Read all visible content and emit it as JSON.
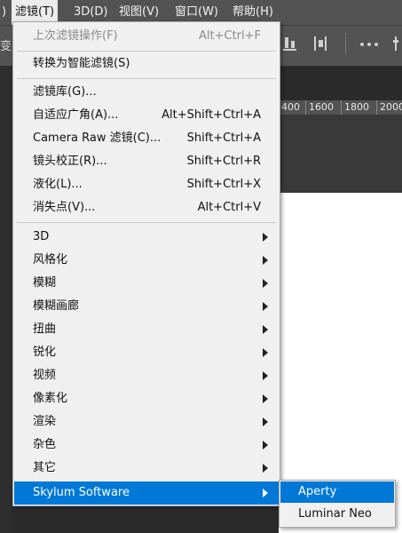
{
  "menubar": {
    "items": [
      {
        "label": ")"
      },
      {
        "label": "滤镜(T)"
      },
      {
        "label": "3D(D)"
      },
      {
        "label": "视图(V)"
      },
      {
        "label": "窗口(W)"
      },
      {
        "label": "帮助(H)"
      }
    ]
  },
  "options_bar": {
    "left_text": "变"
  },
  "ruler": {
    "ticks": [
      "400",
      "1600",
      "1800",
      "2000"
    ]
  },
  "filter_menu": {
    "last_filter": {
      "label": "上次滤镜操作(F)",
      "shortcut": "Alt+Ctrl+F"
    },
    "convert_smart": {
      "label": "转换为智能滤镜(S)"
    },
    "gallery": {
      "label": "滤镜库(G)..."
    },
    "adaptive_wide": {
      "label": "自适应广角(A)...",
      "shortcut": "Alt+Shift+Ctrl+A"
    },
    "camera_raw": {
      "label": "Camera Raw 滤镜(C)...",
      "shortcut": "Shift+Ctrl+A"
    },
    "lens_correction": {
      "label": "镜头校正(R)...",
      "shortcut": "Shift+Ctrl+R"
    },
    "liquify": {
      "label": "液化(L)...",
      "shortcut": "Shift+Ctrl+X"
    },
    "vanishing_point": {
      "label": "消失点(V)...",
      "shortcut": "Alt+Ctrl+V"
    },
    "submenus": [
      {
        "label": "3D"
      },
      {
        "label": "风格化"
      },
      {
        "label": "模糊"
      },
      {
        "label": "模糊画廊"
      },
      {
        "label": "扭曲"
      },
      {
        "label": "锐化"
      },
      {
        "label": "视频"
      },
      {
        "label": "像素化"
      },
      {
        "label": "渲染"
      },
      {
        "label": "杂色"
      },
      {
        "label": "其它"
      }
    ],
    "plugin": {
      "label": "Skylum Software"
    }
  },
  "skylum_submenu": {
    "items": [
      {
        "label": "Aperty"
      },
      {
        "label": "Luminar Neo"
      }
    ]
  },
  "colors": {
    "highlight": "#0078d7",
    "menu_bg": "#f0f0f0",
    "menubar_bg": "#535353"
  }
}
